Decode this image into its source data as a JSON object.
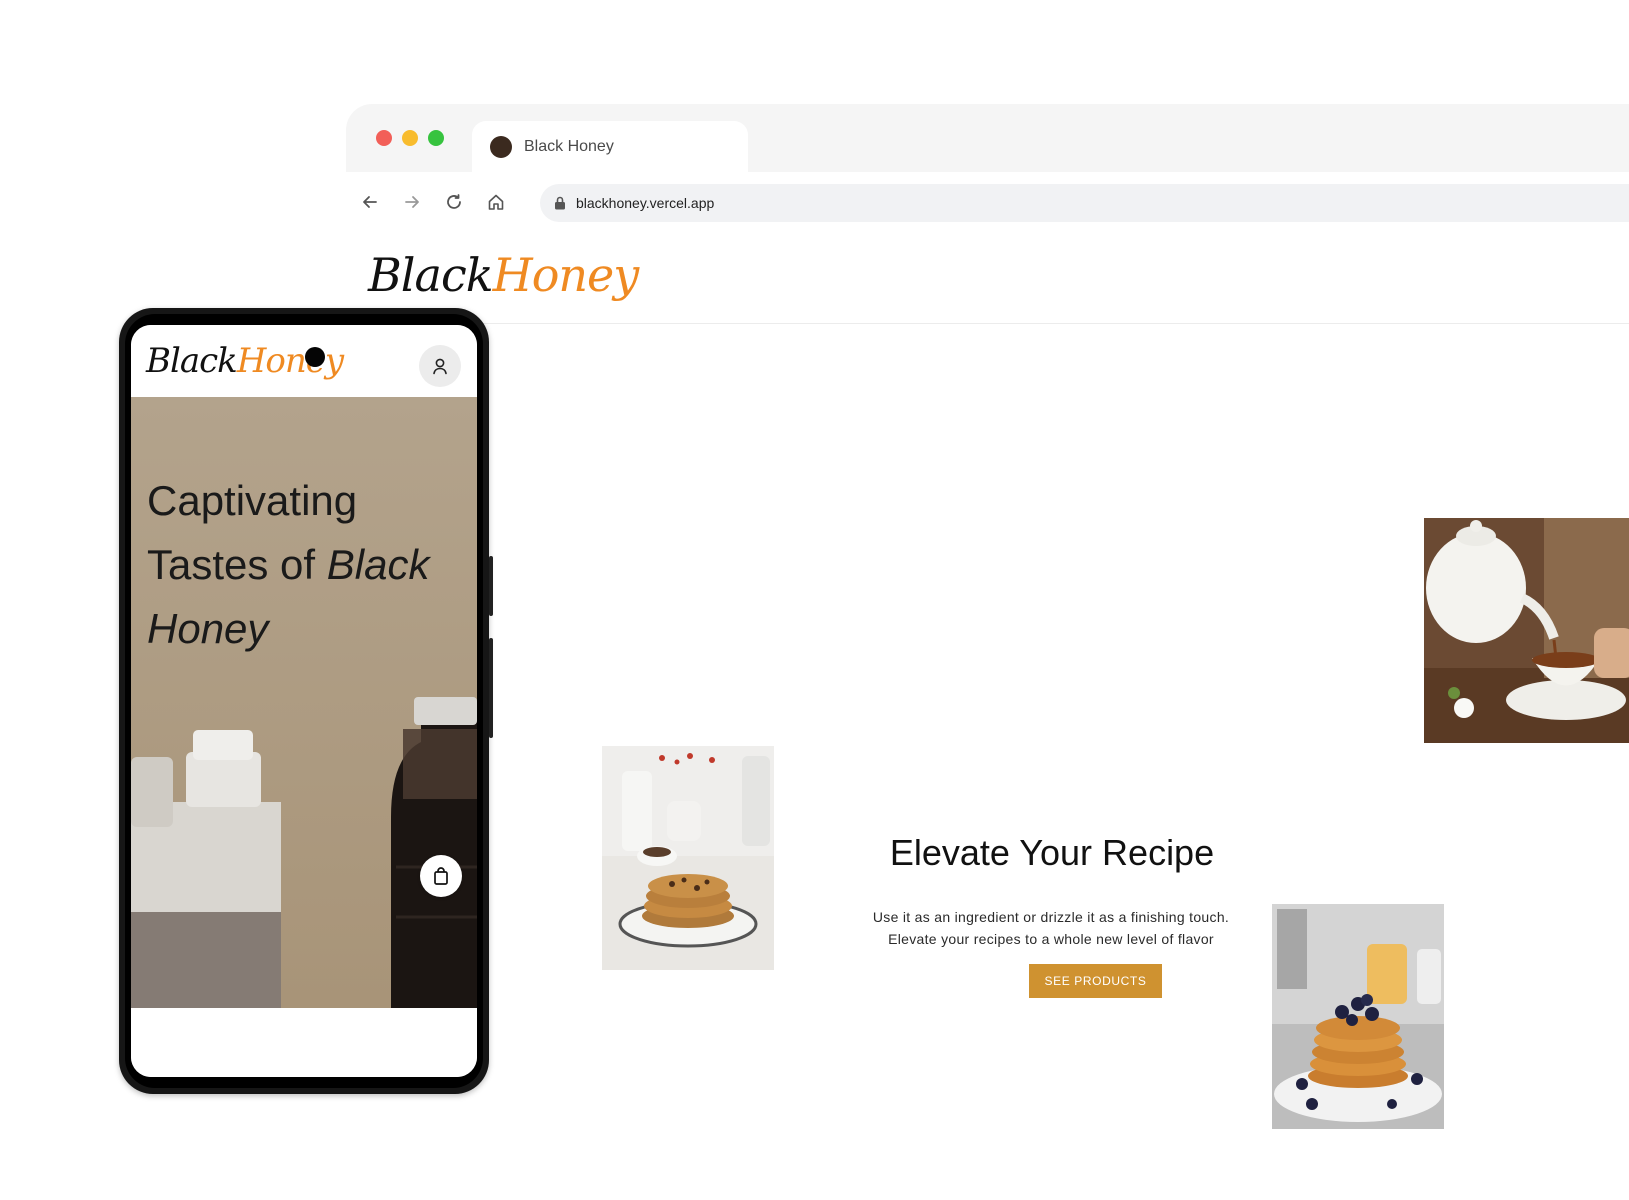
{
  "browser": {
    "tab_title": "Black Honey",
    "url": "blackhoney.vercel.app"
  },
  "site": {
    "logo_black": "Black",
    "logo_honey": "Honey",
    "hero_title": "Elevate Your Recipe",
    "hero_copy_line1": "Use it as an ingredient or drizzle it as a finishing touch.",
    "hero_copy_line2": "Elevate your recipes to a whole new level of flavor",
    "cta_label": "SEE PRODUCTS"
  },
  "mobile": {
    "logo_black": "Black",
    "logo_honey": "Honey",
    "hero_title_plain": "Captivating Tastes of ",
    "hero_title_italic": "Black Honey"
  },
  "colors": {
    "accent_orange": "#ef8a22",
    "cta": "#cf9230",
    "hero_mobile_bg": "#b19f86"
  }
}
